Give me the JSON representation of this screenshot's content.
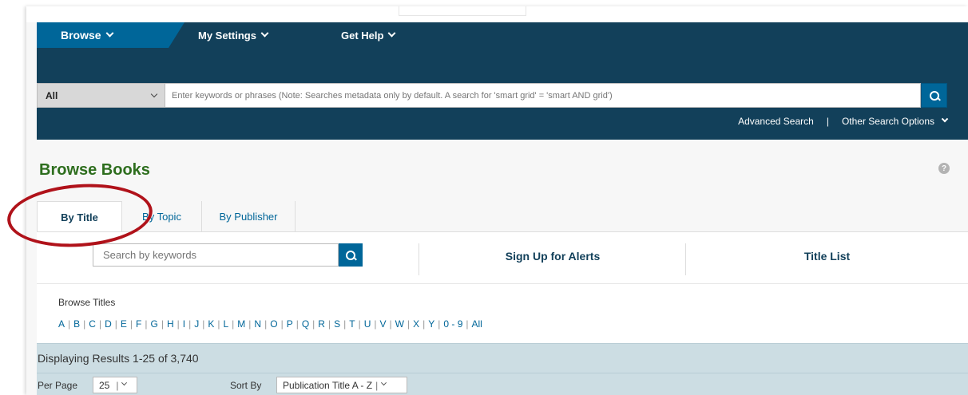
{
  "nav": {
    "browse_label": "Browse",
    "settings_label": "My Settings",
    "help_label": "Get Help"
  },
  "search": {
    "scope_value": "All",
    "placeholder": "Enter keywords or phrases (Note: Searches metadata only by default. A search for 'smart grid' = 'smart AND grid')",
    "advanced_label": "Advanced Search",
    "separator": "|",
    "other_options_label": "Other Search Options"
  },
  "page": {
    "title": "Browse Books",
    "help_icon": "?"
  },
  "tabs": [
    {
      "label": "By Title",
      "active": true
    },
    {
      "label": "By Topic",
      "active": false
    },
    {
      "label": "By Publisher",
      "active": false
    }
  ],
  "filters": {
    "keyword_placeholder": "Search by keywords",
    "alerts_label": "Sign Up for Alerts",
    "title_list_label": "Title List",
    "browse_titles_label": "Browse Titles",
    "letters": [
      "A",
      "B",
      "C",
      "D",
      "E",
      "F",
      "G",
      "H",
      "I",
      "J",
      "K",
      "L",
      "M",
      "N",
      "O",
      "P",
      "Q",
      "R",
      "S",
      "T",
      "U",
      "V",
      "W",
      "X",
      "Y",
      "0 - 9",
      "All"
    ]
  },
  "results": {
    "summary": "Displaying Results 1-25 of 3,740",
    "per_page_label": "Per Page",
    "per_page_value": "25",
    "sort_label": "Sort By",
    "sort_value": "Publication Title A - Z"
  },
  "colors": {
    "header_bg": "#12405a",
    "browse_tab_bg": "#006699",
    "title_green": "#2e6e1e",
    "annotation_red": "#b0121a"
  }
}
